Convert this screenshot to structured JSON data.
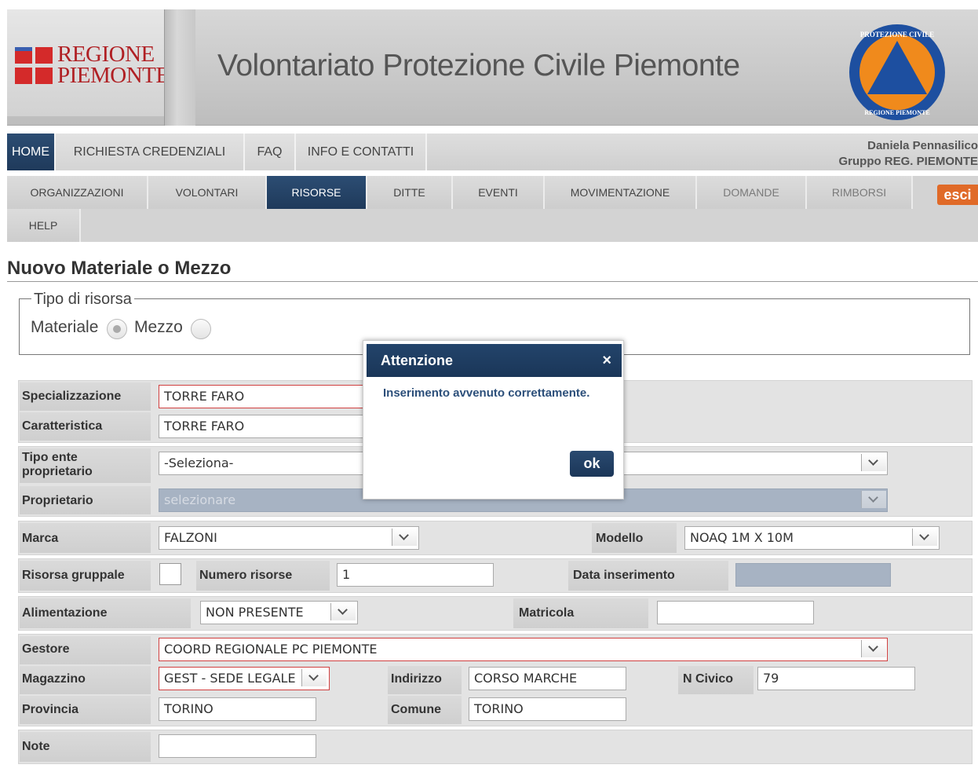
{
  "header": {
    "logo_line1": "REGIONE",
    "logo_line2": "PIEMONTE",
    "site_title": "Volontariato Protezione Civile Piemonte",
    "pc_logo_top": "PROTEZIONE CIVILE",
    "pc_logo_bottom": "REGIONE PIEMONTE"
  },
  "topnav": {
    "items": [
      {
        "label": "HOME",
        "active": true
      },
      {
        "label": "RICHIESTA CREDENZIALI",
        "active": false
      },
      {
        "label": "FAQ",
        "active": false
      },
      {
        "label": "INFO E CONTATTI",
        "active": false
      }
    ],
    "user_name": "Daniela Pennasilico",
    "user_group": "Gruppo REG. PIEMONTE"
  },
  "subnav": {
    "items": [
      {
        "label": "ORGANIZZAZIONI",
        "state": "normal"
      },
      {
        "label": "VOLONTARI",
        "state": "normal"
      },
      {
        "label": "RISORSE",
        "state": "active"
      },
      {
        "label": "DITTE",
        "state": "normal"
      },
      {
        "label": "EVENTI",
        "state": "normal"
      },
      {
        "label": "MOVIMENTAZIONE",
        "state": "normal"
      },
      {
        "label": "DOMANDE",
        "state": "dim"
      },
      {
        "label": "RIMBORSI",
        "state": "dim"
      },
      {
        "label": "HELP",
        "state": "normal"
      }
    ],
    "logout_label": "esci"
  },
  "page": {
    "title": "Nuovo Materiale o Mezzo"
  },
  "tipo_risorsa": {
    "legend": "Tipo di risorsa",
    "materiale_label": "Materiale",
    "mezzo_label": "Mezzo",
    "selected": "Materiale"
  },
  "form": {
    "specializzazione": {
      "label": "Specializzazione",
      "value": "TORRE FARO"
    },
    "caratteristica": {
      "label": "Caratteristica",
      "value": "TORRE FARO"
    },
    "tipo_ente": {
      "label": "Tipo ente proprietario",
      "value": "-Seleziona-"
    },
    "proprietario": {
      "label": "Proprietario",
      "placeholder": "selezionare"
    },
    "marca": {
      "label": "Marca",
      "value": "FALZONI"
    },
    "modello": {
      "label": "Modello",
      "value": "NOAQ 1M X 10M"
    },
    "risorsa_gruppale": {
      "label": "Risorsa gruppale",
      "checked": false
    },
    "numero_risorse": {
      "label": "Numero risorse",
      "value": "1"
    },
    "data_inserimento": {
      "label": "Data inserimento",
      "value": ""
    },
    "alimentazione": {
      "label": "Alimentazione",
      "value": "NON PRESENTE"
    },
    "matricola": {
      "label": "Matricola",
      "value": ""
    },
    "gestore": {
      "label": "Gestore",
      "value": "COORD REGIONALE PC PIEMONTE"
    },
    "magazzino": {
      "label": "Magazzino",
      "value": "GEST - SEDE LEGALE"
    },
    "indirizzo": {
      "label": "Indirizzo",
      "value": "CORSO MARCHE"
    },
    "n_civico": {
      "label": "N Civico",
      "value": "79"
    },
    "provincia": {
      "label": "Provincia",
      "value": "TORINO"
    },
    "comune": {
      "label": "Comune",
      "value": "TORINO"
    },
    "note": {
      "label": "Note",
      "value": ""
    }
  },
  "modal": {
    "title": "Attenzione",
    "close_symbol": "×",
    "message": "Inserimento avvenuto correttamente.",
    "ok_label": "ok"
  },
  "colors": {
    "nav_active": "#1f3a5b",
    "logout": "#e06a28",
    "error_border": "#d04040",
    "region_red": "#d42a2a",
    "pc_blue": "#1d4fa0",
    "pc_orange": "#f08a1c"
  }
}
